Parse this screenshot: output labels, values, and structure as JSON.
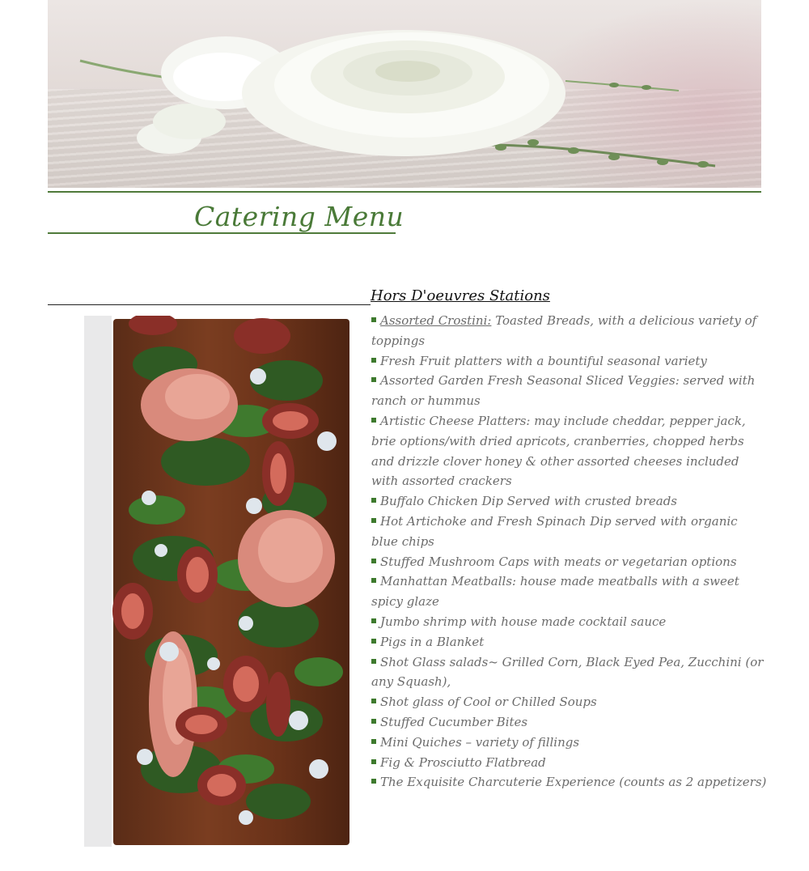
{
  "header": {
    "title": "Catering Menu"
  },
  "section": {
    "title": "Hors D'oeuvres Stations"
  },
  "colors": {
    "accent_green": "#4f7a3a",
    "bullet_green": "#3e7a2e",
    "text_gray": "#6b6b6b"
  },
  "items": [
    {
      "lead": "Assorted Crostini:",
      "text": " Toasted Breads, with a delicious variety of toppings"
    },
    {
      "lead": "",
      "text": "Fresh Fruit platters with a bountiful seasonal variety"
    },
    {
      "lead": "",
      "text": "Assorted Garden Fresh Seasonal Sliced Veggies: served with ranch or hummus"
    },
    {
      "lead": "",
      "text": "Artistic Cheese Platters: may include cheddar, pepper jack, brie options/with dried apricots, cranberries, chopped herbs and drizzle clover honey & other assorted cheeses included with assorted crackers"
    },
    {
      "lead": "",
      "text": "Buffalo Chicken Dip Served with crusted breads"
    },
    {
      "lead": "",
      "text": "Hot Artichoke and Fresh Spinach Dip served with organic blue chips"
    },
    {
      "lead": "",
      "text": "Stuffed Mushroom Caps with meats or vegetarian options"
    },
    {
      "lead": "",
      "text": "Manhattan Meatballs: house made meatballs with a sweet spicy glaze"
    },
    {
      "lead": "",
      "text": "Jumbo shrimp with house made cocktail sauce"
    },
    {
      "lead": "",
      "text": "Pigs in a Blanket"
    },
    {
      "lead": "",
      "text": "Shot Glass salads~ Grilled Corn, Black Eyed Pea, Zucchini (or any Squash),"
    },
    {
      "lead": "",
      "text": "Shot glass of Cool or Chilled Soups"
    },
    {
      "lead": "",
      "text": "Stuffed Cucumber Bites"
    },
    {
      "lead": "",
      "text": "Mini Quiches – variety of fillings"
    },
    {
      "lead": "",
      "text": "Fig & Prosciutto Flatbread"
    },
    {
      "lead": "",
      "text": "The Exquisite Charcuterie Experience (counts as 2 appetizers)"
    }
  ]
}
